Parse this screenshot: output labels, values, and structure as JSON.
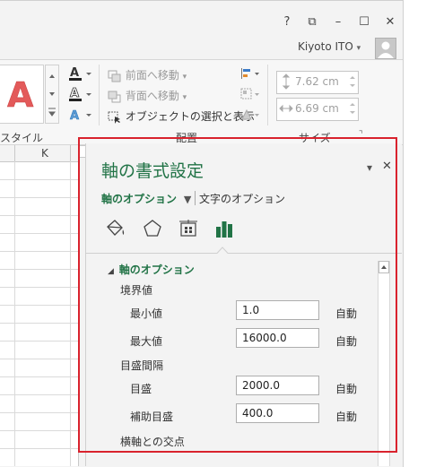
{
  "titlebar": {
    "help": "?",
    "ribbon_display": "⧉",
    "minimize": "–",
    "maximize": "☐",
    "close": "✕",
    "user_name": "Kiyoto ITO",
    "user_dropdown": "▾"
  },
  "ribbon": {
    "bring_forward": "前面へ移動",
    "send_backward": "背面へ移動",
    "selection_pane": "オブジェクトの選択と表示",
    "height_value": "7.62 cm",
    "width_value": "6.69 cm",
    "group_style_partial": "スタイル",
    "group_arrange": "配置",
    "group_size": "サイズ",
    "launcher": "⌝"
  },
  "sheet": {
    "column_header": "K"
  },
  "pane": {
    "title": "軸の書式設定",
    "dropdown_arrow": "▾",
    "close": "✕",
    "tab_axis_options": "軸のオプション",
    "tab_text_options": "文字のオプション",
    "section_title": "軸のオプション",
    "group_bounds": "境界値",
    "min_label": "最小値",
    "min_value": "1.0",
    "max_label": "最大値",
    "max_value": "16000.0",
    "group_units": "目盛間隔",
    "major_label": "目盛",
    "major_value": "2000.0",
    "minor_label": "補助目盛",
    "minor_value": "400.0",
    "auto_label": "自動",
    "cross_label": "横軸との交点"
  },
  "colors": {
    "accent_green": "#217346",
    "highlight_red": "#d9222d"
  }
}
